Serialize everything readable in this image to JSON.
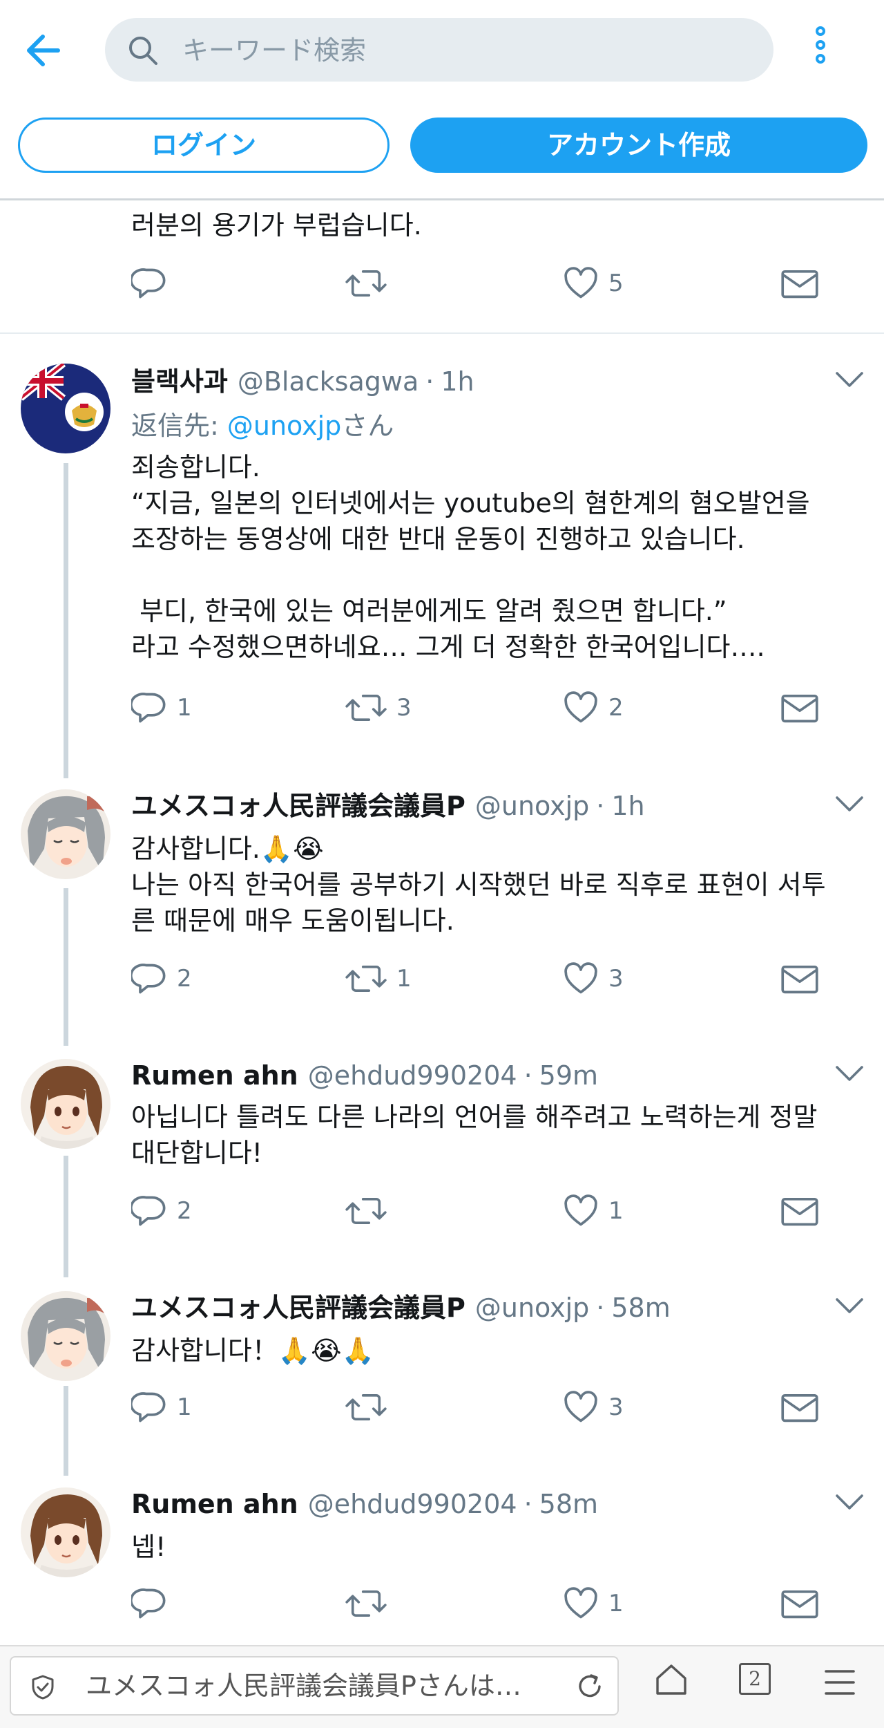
{
  "header": {
    "search_placeholder": "キーワード検索",
    "login_label": "ログイン",
    "signup_label": "アカウント作成"
  },
  "cut_tweet": {
    "text": "러분의 용기가 부럽습니다.",
    "reply_count": "",
    "retweet_count": "",
    "like_count": "5"
  },
  "tweets": [
    {
      "name": "블랙사과",
      "handle": "@Blacksagwa",
      "time": "1h",
      "reply_prefix": "返信先: ",
      "reply_mention": "@unoxjp",
      "reply_suffix": "さん",
      "lines": [
        "죄송합니다.",
        "“지금, 일본의 인터넷에서는 youtube의 혐한계의 혐오발언을",
        "조장하는 동영상에 대한 반대 운동이 진행하고 있습니다.",
        "",
        " 부디, 한국에 있는 여러분에게도 알려 줬으면 합니다.”",
        "라고 수정했으면하네요… 그게 더 정확한 한국어입니다…."
      ],
      "reply_count": "1",
      "retweet_count": "3",
      "like_count": "2"
    },
    {
      "name": "ユメスコォ人民評議会議員P",
      "handle": "@unoxjp",
      "time": "1h",
      "lines": [
        "감사합니다.🙏😭",
        "나는 아직 한국어를 공부하기 시작했던 바로 직후로 표현이 서투",
        "른 때문에 매우 도움이됩니다."
      ],
      "reply_count": "2",
      "retweet_count": "1",
      "like_count": "3"
    },
    {
      "name": "Rumen ahn",
      "handle": "@ehdud990204",
      "time": "59m",
      "lines": [
        "아닙니다 틀려도 다른 나라의 언어를 해주려고 노력하는게 정말",
        "대단합니다!"
      ],
      "reply_count": "2",
      "retweet_count": "",
      "like_count": "1"
    },
    {
      "name": "ユメスコォ人民評議会議員P",
      "handle": "@unoxjp",
      "time": "58m",
      "lines": [
        "감사합니다！🙏😭🙏"
      ],
      "reply_count": "1",
      "retweet_count": "",
      "like_count": "3"
    },
    {
      "name": "Rumen ahn",
      "handle": "@ehdud990204",
      "time": "58m",
      "lines": [
        "넵!"
      ],
      "reply_count": "",
      "retweet_count": "",
      "like_count": "1"
    }
  ],
  "browser": {
    "url_text": "ユメスコォ人民評議会議員Pさんは…",
    "tab_count": "2"
  },
  "colors": {
    "accent": "#1da1f2",
    "muted": "#657786",
    "thread_line": "#ccd6dd"
  }
}
